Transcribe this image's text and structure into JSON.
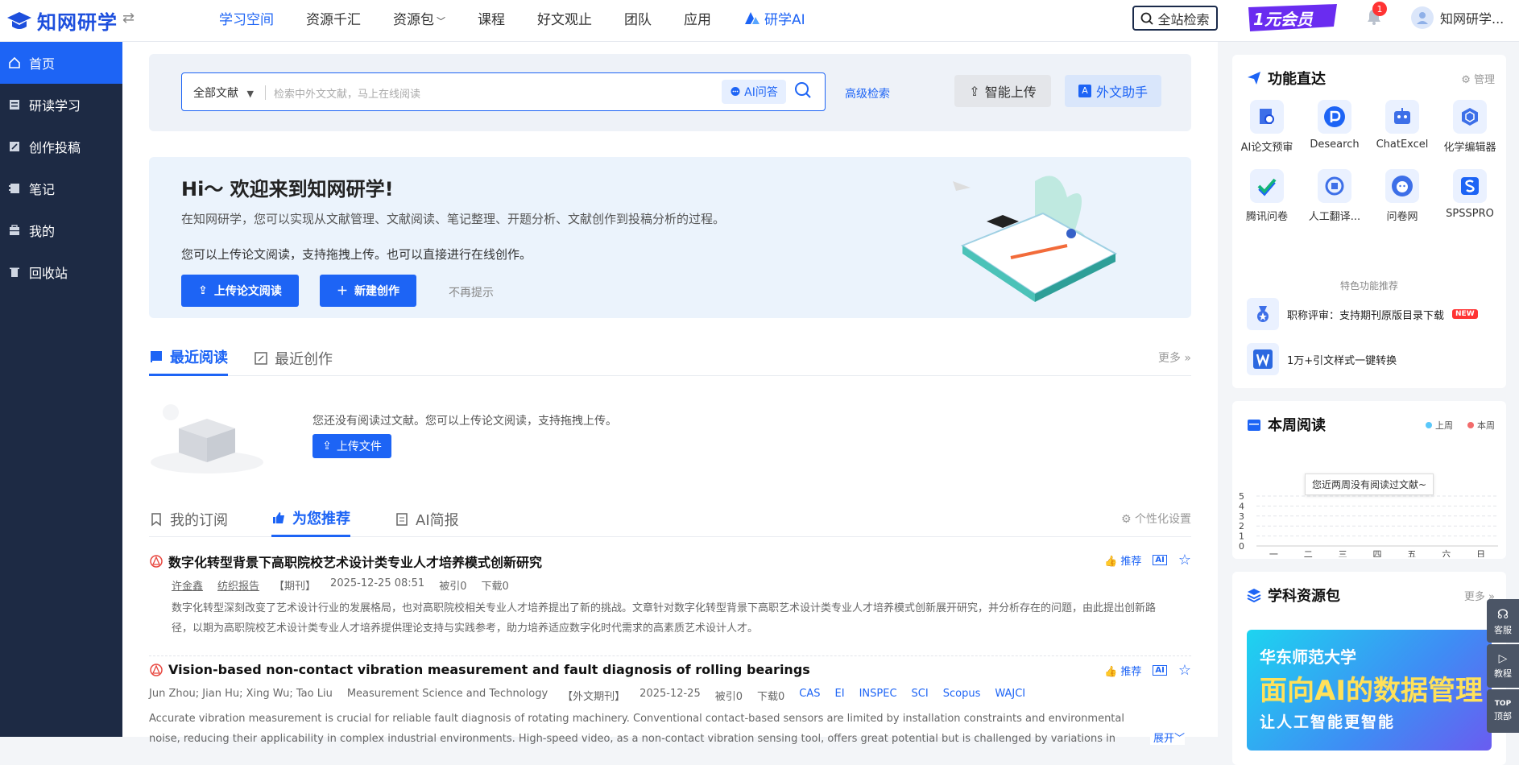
{
  "app": {
    "name": "知网研学"
  },
  "nav": {
    "items": [
      "学习空间",
      "资源千汇",
      "资源包",
      "课程",
      "好文观止",
      "团队",
      "应用"
    ],
    "ai_label": "研学AI",
    "search_all": "全站检索",
    "vip_label": "1元会员",
    "notif_count": "1",
    "user_name": "知网研学..."
  },
  "sidebar": {
    "items": [
      "首页",
      "研读学习",
      "创作投稿",
      "笔记",
      "我的",
      "回收站"
    ]
  },
  "search": {
    "scope": "全部文献",
    "placeholder": "检索中外文文献，马上在线阅读",
    "ai_button": "AI问答",
    "advanced": "高级检索",
    "smart_upload": "智能上传",
    "foreign_assistant": "外文助手"
  },
  "welcome": {
    "title": "Hi～ 欢迎来到知网研学!",
    "line1": "在知网研学，您可以实现从文献管理、文献阅读、笔记整理、开题分析、文献创作到投稿分析的过程。",
    "line2": "您可以上传论文阅读，支持拖拽上传。也可以直接进行在线创作。",
    "btn_upload": "上传论文阅读",
    "btn_new": "新建创作",
    "dismiss": "不再提示"
  },
  "recent": {
    "tab_read": "最近阅读",
    "tab_create": "最近创作",
    "more": "更多",
    "empty": "您还没有阅读过文献。您可以上传论文阅读，支持拖拽上传。",
    "upload_btn": "上传文件"
  },
  "feed": {
    "tab_sub": "我的订阅",
    "tab_rec": "为您推荐",
    "tab_ai": "AI简报",
    "settings": "个性化设置",
    "recommend": "推荐",
    "articles": [
      {
        "title": "数字化转型背景下高职院校艺术设计类专业人才培养模式创新研究",
        "authors": [
          "许金鑫",
          "纺织报告"
        ],
        "type": "【期刊】",
        "date": "2025-12-25 08:51",
        "cited": "被引0",
        "downloads": "下载0",
        "abstract": "数字化转型深刻改变了艺术设计行业的发展格局，也对高职院校相关专业人才培养提出了新的挑战。文章针对数字化转型背景下高职艺术设计类专业人才培养模式创新展开研究，并分析存在的问题，由此提出创新路径，以期为高职院校艺术设计类专业人才培养提供理论支持与实践参考，助力培养适应数字化时代需求的高素质艺术设计人才。"
      },
      {
        "title": "Vision-based non-contact vibration measurement and fault diagnosis of rolling bearings",
        "authors_text": "Jun Zhou; Jian Hu; Xing Wu; Tao Liu",
        "journal": "Measurement Science and Technology",
        "type": "【外文期刊】",
        "date": "2025-12-25",
        "cited": "被引0",
        "downloads": "下载0",
        "tags": [
          "CAS",
          "EI",
          "INSPEC",
          "SCI",
          "Scopus",
          "WAJCI"
        ],
        "abstract": "Accurate vibration measurement is crucial for reliable fault diagnosis of rotating machinery. Conventional contact-based sensors are limited by installation constraints and environmental noise, reducing their applicability in complex industrial environments. High-speed video, as a non-contact vibration sensing tool, offers great potential but is challenged by variations in illumination and noise, making",
        "expand": "展开"
      }
    ]
  },
  "functions": {
    "title": "功能直达",
    "manage": "管理",
    "items": [
      "AI论文预审",
      "Desearch",
      "ChatExcel",
      "化学编辑器",
      "腾讯问卷",
      "人工翻译...",
      "问卷网",
      "SPSSPRO"
    ],
    "featured_title": "特色功能推荐",
    "featured": [
      {
        "label": "职称评审：支持期刊原版目录下载",
        "badge": "NEW"
      },
      {
        "label": "1万+引文样式一键转换"
      }
    ]
  },
  "weekly": {
    "title": "本周阅读",
    "legend_last": "上周",
    "legend_this": "本周",
    "tooltip": "您近两周没有阅读过文献~",
    "colors": {
      "last": "#5ac8fa",
      "this": "#f26b6b"
    }
  },
  "chart_data": {
    "type": "line",
    "categories": [
      "一",
      "二",
      "三",
      "四",
      "五",
      "六",
      "日"
    ],
    "series": [
      {
        "name": "上周",
        "values": [
          0,
          0,
          0,
          0,
          0,
          0,
          0
        ]
      },
      {
        "name": "本周",
        "values": [
          0,
          0,
          0,
          0,
          0,
          0,
          0
        ]
      }
    ],
    "yticks": [
      "5",
      "4",
      "3",
      "2",
      "1",
      "0"
    ],
    "ylim": [
      0,
      5
    ],
    "grid": true,
    "legend": "top-right"
  },
  "subject": {
    "title": "学科资源包",
    "more": "更多",
    "banner_line1": "华东师范大学",
    "banner_line2": "面向AI的数据管理",
    "banner_line3": "让人工智能更智能"
  },
  "float": {
    "service": "客服",
    "tutorial": "教程",
    "top": "顶部",
    "top_en": "TOP"
  }
}
